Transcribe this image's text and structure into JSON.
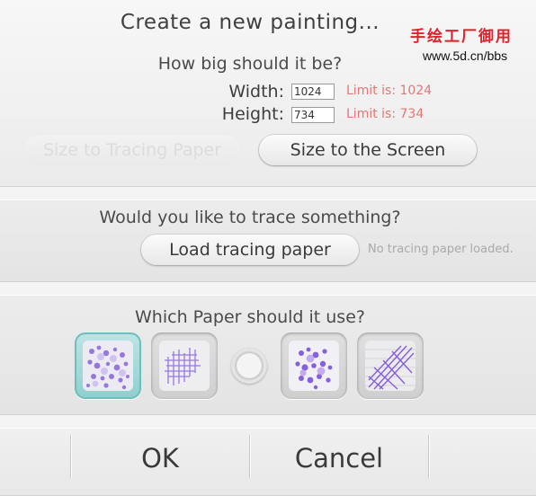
{
  "dialog": {
    "title": "Create a new painting..."
  },
  "watermark": {
    "brand_text": "手绘工厂御用",
    "url": "www.5d.cn/bbs"
  },
  "size": {
    "question": "How big should it be?",
    "width_label": "Width:",
    "width_value": "1024",
    "width_limit": "Limit is: 1024",
    "height_label": "Height:",
    "height_value": "734",
    "height_limit": "Limit is: 734",
    "size_to_tracing_label": "Size to Tracing Paper",
    "size_to_tracing_enabled": false,
    "size_to_screen_label": "Size to the Screen"
  },
  "tracing": {
    "question": "Would you like to trace something?",
    "load_label": "Load tracing paper",
    "status": "No tracing paper loaded."
  },
  "paper": {
    "question": "Which Paper should it use?",
    "options": [
      {
        "icon": "paper-swatch-speckled-icon",
        "selected": true
      },
      {
        "icon": "paper-swatch-crosshatch-icon",
        "selected": false
      },
      {
        "icon": "radio-none-icon",
        "selected": false
      },
      {
        "icon": "paper-swatch-speckled-purple-icon",
        "selected": false
      },
      {
        "icon": "paper-swatch-diagonal-crosshatch-icon",
        "selected": false
      }
    ]
  },
  "actions": {
    "ok_label": "OK",
    "cancel_label": "Cancel"
  },
  "colors": {
    "accent_selected": "#8fcfcf",
    "limit_text": "#e07878",
    "watermark_red": "#e0202a",
    "swatch_purple": "#7b4fd8"
  }
}
